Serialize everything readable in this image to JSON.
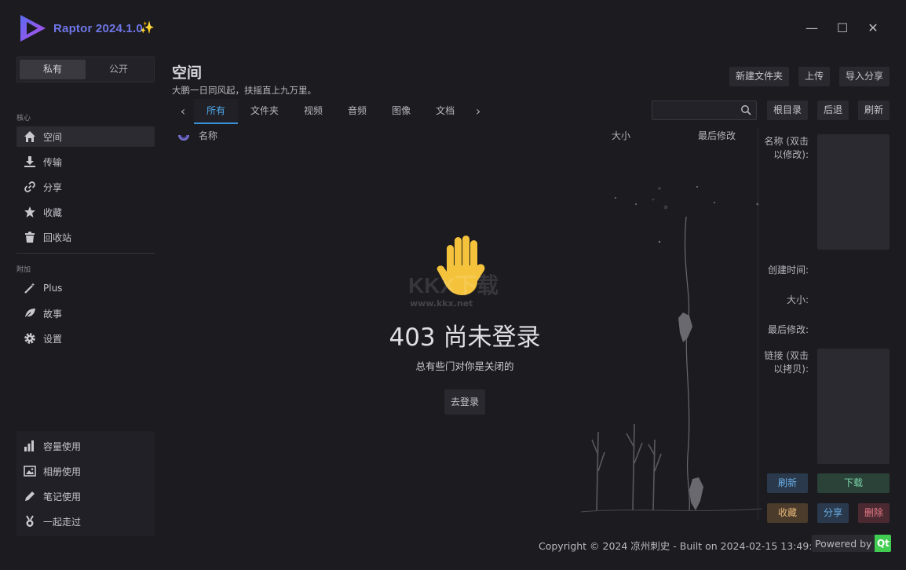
{
  "app": {
    "title": "Raptor 2024.1.0"
  },
  "window": {
    "minimize": "—",
    "maximize": "☐",
    "close": "✕"
  },
  "sidebar": {
    "segments": [
      "私有",
      "公开"
    ],
    "core_label": "核心",
    "core_items": [
      {
        "label": "空间",
        "icon": "home-icon"
      },
      {
        "label": "传输",
        "icon": "download-icon"
      },
      {
        "label": "分享",
        "icon": "link-icon"
      },
      {
        "label": "收藏",
        "icon": "star-icon"
      },
      {
        "label": "回收站",
        "icon": "trash-icon"
      }
    ],
    "extra_label": "附加",
    "extra_items": [
      {
        "label": "Plus",
        "icon": "magic-wand-icon"
      },
      {
        "label": "故事",
        "icon": "leaf-icon"
      },
      {
        "label": "设置",
        "icon": "gear-icon"
      }
    ],
    "usage_items": [
      {
        "label": "容量使用",
        "icon": "bar-chart-icon"
      },
      {
        "label": "相册使用",
        "icon": "image-icon"
      },
      {
        "label": "笔记使用",
        "icon": "pencil-icon"
      },
      {
        "label": "一起走过",
        "icon": "medal-icon"
      }
    ]
  },
  "header": {
    "title": "空间",
    "subtitle": "大鹏一日同风起，扶摇直上九万里。",
    "buttons": [
      "新建文件夹",
      "上传",
      "导入分享"
    ]
  },
  "tabs": [
    "所有",
    "文件夹",
    "视频",
    "音频",
    "图像",
    "文档"
  ],
  "toolbar": {
    "search_placeholder": "",
    "buttons": [
      "根目录",
      "后退",
      "刷新"
    ]
  },
  "columns": {
    "name": "名称",
    "size": "大小",
    "modified": "最后修改"
  },
  "message": {
    "title": "403 尚未登录",
    "subtitle": "总有些门对你是关闭的",
    "button": "去登录",
    "watermark": "KKX下载",
    "watermark_url": "www.kkx.net"
  },
  "details": {
    "name_label": "名称 (双击以修改):",
    "created_label": "创建时间:",
    "size_label": "大小:",
    "modified_label": "最后修改:",
    "link_label": "链接 (双击以拷贝):",
    "actions": {
      "refresh": "刷新",
      "download": "下载",
      "favorite": "收藏",
      "share": "分享",
      "delete": "删除"
    }
  },
  "footer": {
    "copyright": "Copyright © 2024 凉州刺史 - Built on 2024-02-15 13:49:59",
    "powered": "Powered by",
    "qt": "Qt"
  },
  "colors": {
    "accent": "#3a90d8",
    "brand": "#6f77e8",
    "refresh_bg": "#2a3a4c",
    "download_bg": "#2b4238",
    "favorite_bg": "#4a3b2a",
    "share_bg": "#2a3a4c",
    "delete_bg": "#4a2a30"
  }
}
